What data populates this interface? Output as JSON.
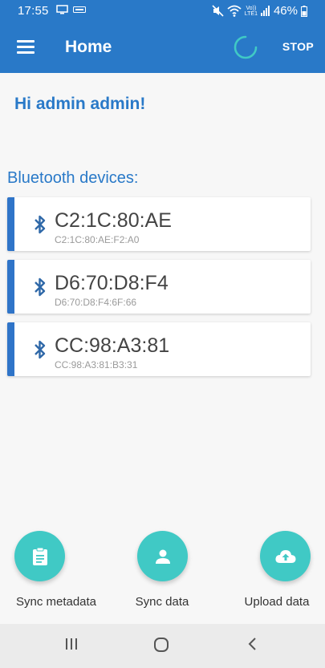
{
  "status_bar": {
    "time": "17:55",
    "lte_top": "Vo))",
    "lte_bottom": "LTE1",
    "battery": "46%"
  },
  "app_bar": {
    "title": "Home",
    "stop_label": "STOP"
  },
  "greeting": "Hi admin admin!",
  "section_title": "Bluetooth devices:",
  "devices": [
    {
      "name": "C2:1C:80:AE",
      "mac": "C2:1C:80:AE:F2:A0"
    },
    {
      "name": "D6:70:D8:F4",
      "mac": "D6:70:D8:F4:6F:66"
    },
    {
      "name": "CC:98:A3:81",
      "mac": "CC:98:A3:81:B3:31"
    }
  ],
  "actions": [
    {
      "label": "Sync metadata",
      "icon": "clipboard-icon"
    },
    {
      "label": "Sync data",
      "icon": "person-icon"
    },
    {
      "label": "Upload data",
      "icon": "cloud-upload-icon"
    }
  ],
  "colors": {
    "primary": "#2979c8",
    "accent": "#40c9c5",
    "card_stripe": "#2f74c8"
  }
}
